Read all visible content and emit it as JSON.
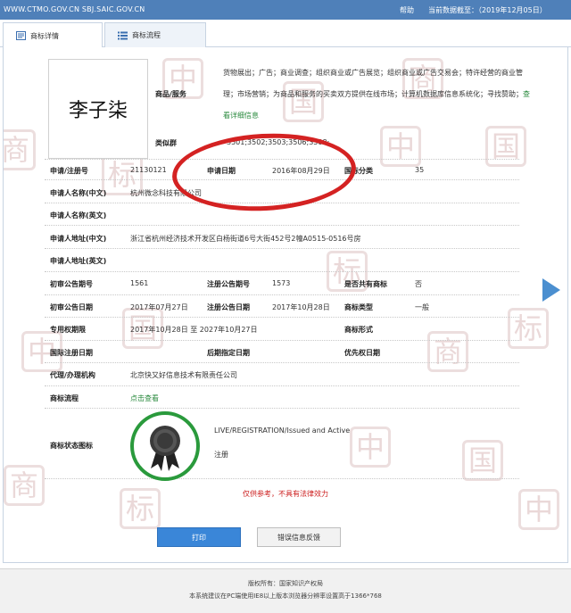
{
  "header": {
    "site_domains": "WWW.CTMO.GOV.CN SBJ.SAIC.GOV.CN",
    "help_label": "帮助",
    "data_deadline": "当前数据截至：（2019年12月05日）"
  },
  "tabs": [
    {
      "label": "商标详情",
      "icon": "document-icon",
      "active": true
    },
    {
      "label": "商标流程",
      "icon": "list-icon",
      "active": false
    }
  ],
  "trademark": {
    "mark_text": "李子柒",
    "goods_services_label": "商品/服务",
    "goods_services_text": "货物展出；广告；商业调查；组织商业或广告展览；组织商业或广告交易会；特许经营的商业管理；市场营销；为商品和服务的买卖双方提供在线市场；计算机数据库信息系统化；寻找赞助；",
    "goods_services_more_link": "查看详细信息",
    "similar_group_label": "类似群",
    "similar_group_value": "3501;3502;3503;3506;3508;"
  },
  "details": {
    "reg_no_label": "申请/注册号",
    "reg_no_value": "21130121",
    "app_date_label": "申请日期",
    "app_date_value": "2016年08月29日",
    "intl_class_label": "国际分类",
    "intl_class_value": "35",
    "applicant_cn_label": "申请人名称(中文)",
    "applicant_cn_value": "杭州微念科技有限公司",
    "applicant_en_label": "申请人名称(英文)",
    "address_cn_label": "申请人地址(中文)",
    "address_cn_value": "浙江省杭州经济技术开发区白杨街道6号大街452号2幢A0515-0516号房",
    "address_en_label": "申请人地址(英文)",
    "prelim_issue_label": "初审公告期号",
    "prelim_issue_value": "1561",
    "reg_issue_label": "注册公告期号",
    "reg_issue_value": "1573",
    "shared_label": "是否共有商标",
    "shared_value": "否",
    "prelim_date_label": "初审公告日期",
    "prelim_date_value": "2017年07月27日",
    "reg_date_label": "注册公告日期",
    "reg_date_value": "2017年10月28日",
    "mark_type_label": "商标类型",
    "mark_type_value": "一般",
    "exclusive_period_label": "专用权期限",
    "exclusive_period_value": "2017年10月28日 至 2027年10月27日",
    "mark_form_label": "商标形式",
    "intl_reg_date_label": "国际注册日期",
    "later_designation_label": "后期指定日期",
    "priority_date_label": "优先权日期",
    "agent_label": "代理/办理机构",
    "agent_value": "北京快又好信息技术有限责任公司",
    "process_label": "商标流程",
    "process_link": "点击查看",
    "status_icon_label": "商标状态图标",
    "status_en": "LIVE/REGISTRATION/Issued and Active",
    "status_cn": "注册"
  },
  "disclaimer": "仅供参考，不具有法律效力",
  "buttons": {
    "print": "打印",
    "report_error": "错误信息反馈"
  },
  "footer": {
    "copyright": "版权所有：国家知识产权局",
    "browser_tip": "本系统建议在PC端使用IE8以上版本浏览器分辨率设置高于1366*768"
  },
  "colors": {
    "header_bg": "#4f80b9",
    "link_green": "#2a8a3e",
    "disclaimer_red": "#cc1d1d",
    "print_button": "#3a86d8",
    "annotation_circle": "#d42222",
    "badge_ring": "#2a9a3c"
  }
}
